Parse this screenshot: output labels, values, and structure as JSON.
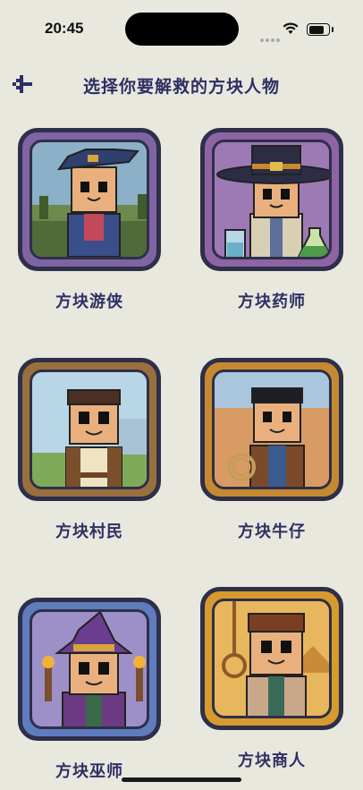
{
  "status_bar": {
    "time": "20:45"
  },
  "header": {
    "title": "选择你要解救的方块人物",
    "back_icon": "back-arrow-icon"
  },
  "characters": [
    {
      "name": "方块游侠",
      "frame_color": "#7e64a3",
      "bg": "#8cb0c8"
    },
    {
      "name": "方块药师",
      "frame_color": "#8e64a5",
      "bg": "#9d7ab4"
    },
    {
      "name": "方块村民",
      "frame_color": "#9a6f3e",
      "bg": "#b9d6e6"
    },
    {
      "name": "方块牛仔",
      "frame_color": "#c58a31",
      "bg": "#d6a466"
    },
    {
      "name": "方块巫师",
      "frame_color": "#5f7cbf",
      "bg": "#9d90c8"
    },
    {
      "name": "方块商人",
      "frame_color": "#d79a2e",
      "bg": "#e8b65c"
    }
  ]
}
